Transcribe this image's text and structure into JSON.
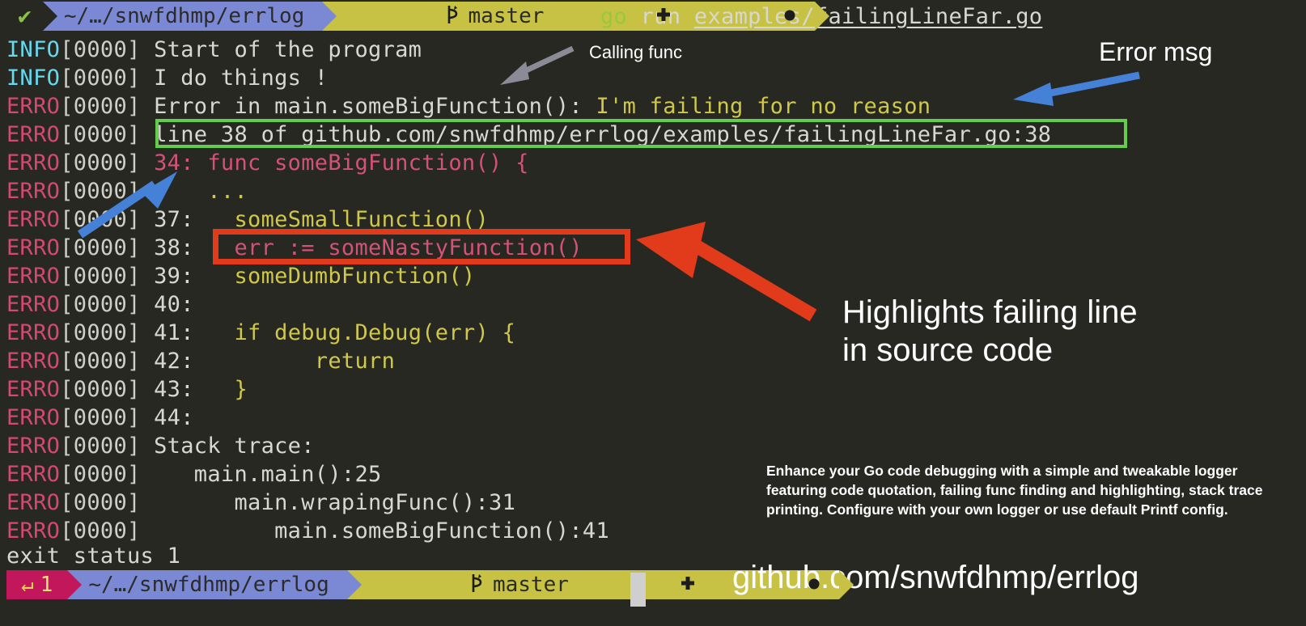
{
  "terminal": {
    "background": "#272822",
    "prompt_top": {
      "status_icon": "checkmark-icon",
      "status_glyph": "✔",
      "path": "~/…/snwfdhmp/errlog",
      "git_branch_icon": "git-branch-icon",
      "git_branch": "master",
      "git_staged_icon": "plus-icon",
      "git_dirty_icon": "dot-icon",
      "path_bg": "#7b88d4",
      "git_bg": "#c8c244"
    },
    "command": {
      "program": "go",
      "args": " run ",
      "file": "examples/failingLineFar.go"
    },
    "prompt_bottom": {
      "exit_icon": "return-arrow-icon",
      "exit_glyph": "↵",
      "exit_code": "1",
      "exit_bg": "#c2185b",
      "path": "~/…/snwfdhmp/errlog",
      "git_branch_icon": "git-branch-icon",
      "git_branch": "master",
      "git_staged_icon": "plus-icon",
      "git_dirty_icon": "dot-icon"
    },
    "exit_status": "exit status 1",
    "log_lines": [
      {
        "level": "INFO",
        "time": "0000",
        "parts": [
          {
            "text": "Start of the program",
            "style": "msg"
          }
        ]
      },
      {
        "level": "INFO",
        "time": "0000",
        "parts": [
          {
            "text": "I do things !",
            "style": "msg"
          }
        ]
      },
      {
        "level": "ERRO",
        "time": "0000",
        "parts": [
          {
            "text": "Error in main.someBigFunction(): ",
            "style": "msg"
          },
          {
            "text": "I'm failing for no reason",
            "style": "msg-yellow"
          }
        ]
      },
      {
        "level": "ERRO",
        "time": "0000",
        "parts": [
          {
            "text": "line 38 of github.com/snwfdhmp/errlog/examples/failingLineFar.go:38",
            "style": "msg"
          }
        ]
      },
      {
        "level": "ERRO",
        "time": "0000",
        "parts": [
          {
            "text": "34: func someBigFunction() {",
            "style": "msg-pink"
          }
        ]
      },
      {
        "level": "ERRO",
        "time": "0000",
        "parts": [
          {
            "text": "    ...",
            "style": "msg-dots"
          }
        ]
      },
      {
        "level": "ERRO",
        "time": "0000",
        "parts": [
          {
            "text": "37: ",
            "style": "lnum"
          },
          {
            "text": "  someSmallFunction()",
            "style": "msg-code"
          }
        ]
      },
      {
        "level": "ERRO",
        "time": "0000",
        "parts": [
          {
            "text": "38: ",
            "style": "lnum"
          },
          {
            "text": "  err := someNastyFunction()",
            "style": "msg-pink"
          }
        ]
      },
      {
        "level": "ERRO",
        "time": "0000",
        "parts": [
          {
            "text": "39: ",
            "style": "lnum"
          },
          {
            "text": "  someDumbFunction()",
            "style": "msg-code"
          }
        ]
      },
      {
        "level": "ERRO",
        "time": "0000",
        "parts": [
          {
            "text": "40: ",
            "style": "lnum"
          }
        ]
      },
      {
        "level": "ERRO",
        "time": "0000",
        "parts": [
          {
            "text": "41: ",
            "style": "lnum"
          },
          {
            "text": "  if debug.Debug(err) {",
            "style": "msg-code"
          }
        ]
      },
      {
        "level": "ERRO",
        "time": "0000",
        "parts": [
          {
            "text": "42: ",
            "style": "lnum"
          },
          {
            "text": "        return",
            "style": "msg-code"
          }
        ]
      },
      {
        "level": "ERRO",
        "time": "0000",
        "parts": [
          {
            "text": "43: ",
            "style": "lnum"
          },
          {
            "text": "  }",
            "style": "msg-code"
          }
        ]
      },
      {
        "level": "ERRO",
        "time": "0000",
        "parts": [
          {
            "text": "44: ",
            "style": "lnum"
          }
        ]
      },
      {
        "level": "ERRO",
        "time": "0000",
        "parts": [
          {
            "text": "Stack trace:",
            "style": "msg"
          }
        ]
      },
      {
        "level": "ERRO",
        "time": "0000",
        "parts": [
          {
            "text": "   main.main():25",
            "style": "msg"
          }
        ]
      },
      {
        "level": "ERRO",
        "time": "0000",
        "parts": [
          {
            "text": "      main.wrapingFunc():31",
            "style": "msg"
          }
        ]
      },
      {
        "level": "ERRO",
        "time": "0000",
        "parts": [
          {
            "text": "         main.someBigFunction():41",
            "style": "msg"
          }
        ]
      }
    ]
  },
  "annotations": {
    "calling_func": "Calling func",
    "error_msg": "Error msg",
    "highlights_line1": "Highlights failing line",
    "highlights_line2": "in source code",
    "description": "Enhance your Go code debugging with a simple and tweakable logger featuring code quotation, failing func finding and highlighting, stack trace printing. Configure with your own logger or use default Printf config.",
    "github_url": "github.com/snwfdhmp/errlog",
    "arrow_grey_color": "#8b8b98",
    "arrow_blue_color": "#4681d8",
    "arrow_red_color": "#e23b1c",
    "green_box_color": "#66cc4c",
    "red_box_color": "#e23b1c"
  }
}
